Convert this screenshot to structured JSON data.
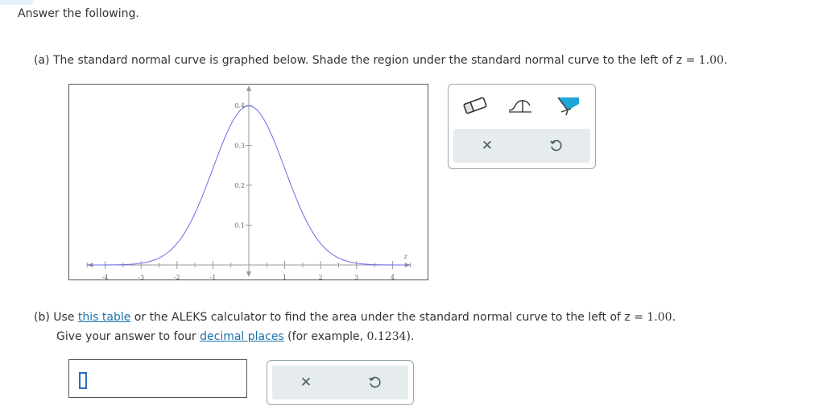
{
  "heading": "Answer the following.",
  "part_a": {
    "prefix": "(a) The standard normal curve is graphed below. Shade the region under the standard normal curve to the left of z = ",
    "value": "1.00."
  },
  "part_b": {
    "prefix": "(b) Use ",
    "link": "this table",
    "middle": " or the ALEKS calculator to find the area under the standard normal curve to the left of z = ",
    "value": "1.00.",
    "line2_prefix": "Give your answer to four ",
    "line2_link": "decimal places",
    "line2_middle": " (for example, ",
    "example": "0.1234",
    "line2_suffix": ")."
  },
  "answer_input": {
    "value": ""
  },
  "colors": {
    "curve": "#6b6be8",
    "link": "#1a73a8",
    "accent": "#1fa6d8",
    "panel": "#e6ebee"
  },
  "icons": {
    "tool_1": "eraser-icon",
    "tool_2": "region-bracket-icon",
    "tool_3": "shade-fill-icon",
    "clear": "x-icon",
    "undo": "undo-icon"
  },
  "chart_data": {
    "type": "line",
    "function": "standard normal density",
    "mean": 0,
    "sd": 1,
    "xlim": [
      -4.5,
      4.5
    ],
    "ylim": [
      0,
      0.4
    ],
    "x_ticks": [
      "-4",
      "-3",
      "-2",
      "-1",
      "1",
      "2",
      "3",
      "4"
    ],
    "y_ticks": [
      "0.1",
      "0.2",
      "0.3",
      "0.4"
    ],
    "x_axis_label": "z"
  }
}
